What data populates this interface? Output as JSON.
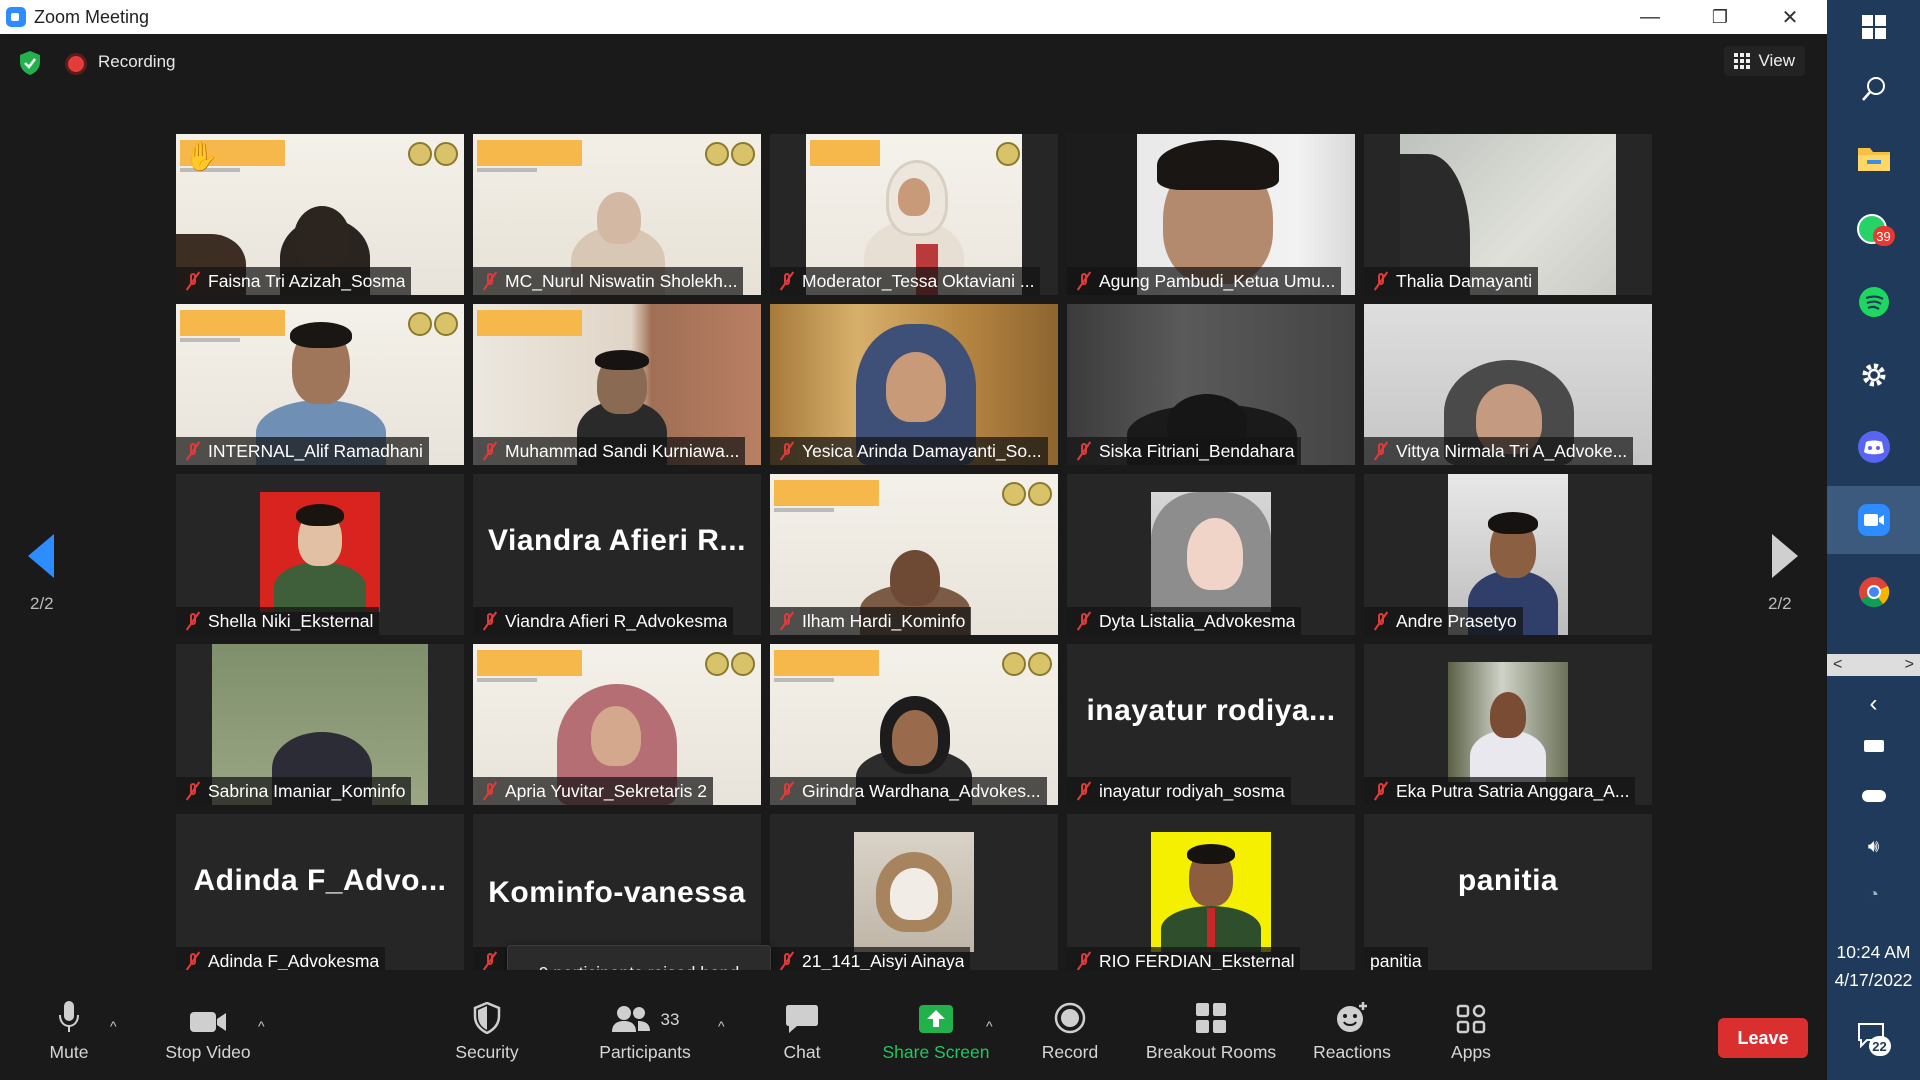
{
  "window": {
    "title": "Zoom Meeting",
    "minimize": "—",
    "restore": "❐",
    "close": "✕"
  },
  "topbar": {
    "recording_label": "Recording",
    "view_label": "View"
  },
  "nav": {
    "left_page": "2/2",
    "right_page": "2/2"
  },
  "participants": [
    {
      "name": "Faisna Tri Azizah_Sosma",
      "muted": true
    },
    {
      "name": "MC_Nurul Niswatin Sholekh...",
      "muted": true
    },
    {
      "name": "Moderator_Tessa Oktaviani ...",
      "muted": true
    },
    {
      "name": "Agung Pambudi_Ketua Umu...",
      "muted": true
    },
    {
      "name": "Thalia Damayanti",
      "muted": true
    },
    {
      "name": "INTERNAL_Alif Ramadhani",
      "muted": true
    },
    {
      "name": "Muhammad Sandi Kurniawa...",
      "muted": true
    },
    {
      "name": "Yesica Arinda Damayanti_So...",
      "muted": true
    },
    {
      "name": "Siska Fitriani_Bendahara",
      "muted": true
    },
    {
      "name": "Vittya Nirmala Tri A_Advoke...",
      "muted": true
    },
    {
      "name": "Shella Niki_Eksternal",
      "muted": true
    },
    {
      "name": "Viandra Afieri R_Advokesma",
      "muted": true,
      "big_name": "Viandra  Afieri  R..."
    },
    {
      "name": "Ilham Hardi_Kominfo",
      "muted": true
    },
    {
      "name": "Dyta Listalia_Advokesma",
      "muted": true
    },
    {
      "name": "Andre Prasetyo",
      "muted": true
    },
    {
      "name": "Sabrina Imaniar_Kominfo",
      "muted": true
    },
    {
      "name": "Apria Yuvitar_Sekretaris 2",
      "muted": true
    },
    {
      "name": "Girindra Wardhana_Advokes...",
      "muted": true
    },
    {
      "name": "inayatur rodiyah_sosma",
      "muted": true,
      "big_name": "inayatur  rodiya..."
    },
    {
      "name": "Eka Putra Satria Anggara_A...",
      "muted": true
    },
    {
      "name": "Adinda F_Advokesma",
      "muted": true,
      "big_name": "Adinda  F_Advo..."
    },
    {
      "name": "",
      "muted": true,
      "big_name": "Kominfo-vanessa"
    },
    {
      "name": "21_141_Aisyi Ainaya",
      "muted": true
    },
    {
      "name": "RIO FERDIAN_Eksternal",
      "muted": true
    },
    {
      "name": "panitia",
      "muted": false,
      "big_name": "panitia"
    }
  ],
  "tooltip": {
    "text": "9 participants raised hand"
  },
  "toolbar": {
    "mute": "Mute",
    "stop_video": "Stop Video",
    "security": "Security",
    "participants": "Participants",
    "participants_count": "33",
    "chat": "Chat",
    "share_screen": "Share Screen",
    "record": "Record",
    "breakout_rooms": "Breakout Rooms",
    "reactions": "Reactions",
    "apps": "Apps",
    "leave": "Leave"
  },
  "taskbar": {
    "whatsapp_badge": "39",
    "time": "10:24 AM",
    "date": "4/17/2022",
    "notification_count": "22"
  },
  "colors": {
    "accent_blue": "#2d8cff",
    "share_green": "#22b14c",
    "leave_red": "#d9302f",
    "muted_red": "#e03b3b",
    "banner_orange": "#f6b84a"
  }
}
